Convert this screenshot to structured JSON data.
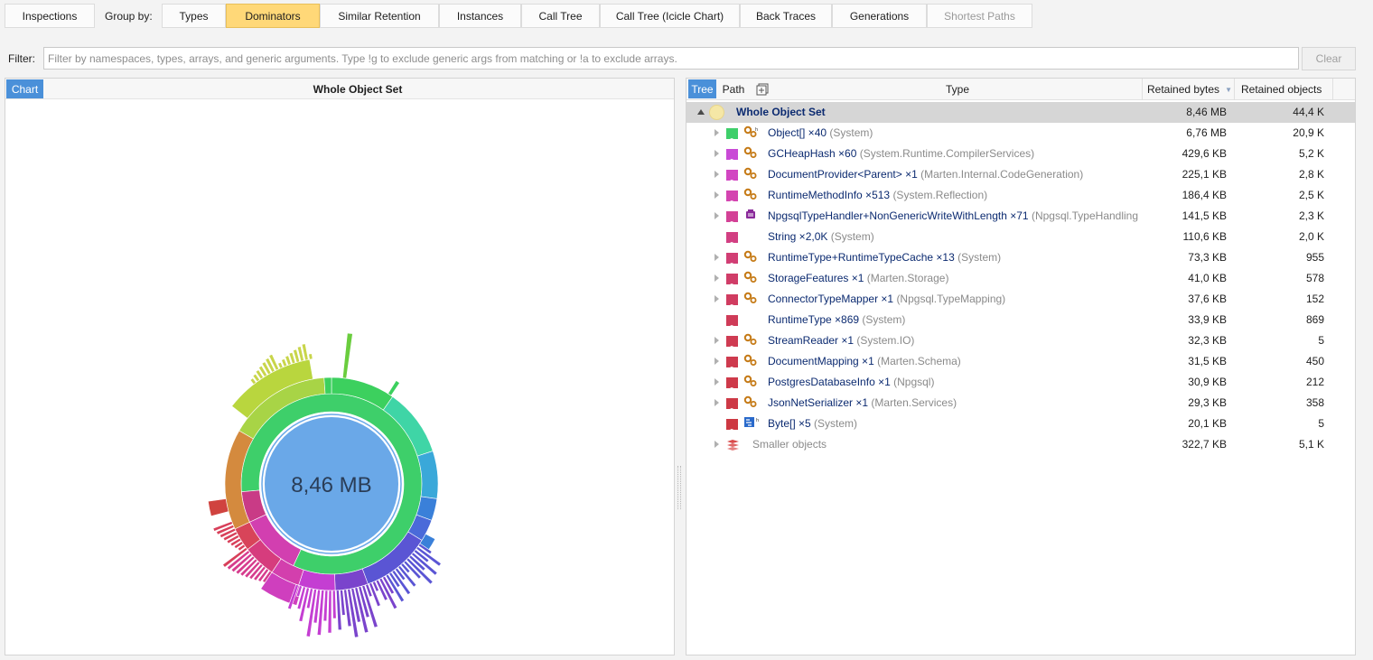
{
  "topbar": {
    "inspections": "Inspections",
    "group_by_label": "Group by:",
    "tabs": [
      "Types",
      "Dominators",
      "Similar Retention",
      "Instances",
      "Call Tree",
      "Call Tree (Icicle Chart)",
      "Back Traces",
      "Generations",
      "Shortest Paths"
    ],
    "active_tab": "Dominators",
    "disabled_tab": "Shortest Paths"
  },
  "filter": {
    "label": "Filter:",
    "placeholder": "Filter by namespaces, types, arrays, and generic arguments. Type !g to exclude generic args from matching or !a to exclude arrays.",
    "value": "",
    "clear_label": "Clear"
  },
  "left_pane": {
    "chart_tab": "Chart",
    "title": "Whole Object Set",
    "center_label": "8,46 MB"
  },
  "right_pane": {
    "tree_tab": "Tree",
    "path_tab": "Path",
    "columns": {
      "type": "Type",
      "retained_bytes": "Retained bytes",
      "retained_objects": "Retained objects"
    },
    "root": {
      "name": "Whole Object Set",
      "bytes": "8,46 MB",
      "objects": "44,4 K"
    },
    "rows": [
      {
        "name": "Object[] ×40",
        "ns": "(System)",
        "bytes": "6,76 MB",
        "objects": "20,9 K",
        "color": "#3ecf6a",
        "expandable": true,
        "icon": "array-gear-icon"
      },
      {
        "name": "GCHeapHash ×60",
        "ns": "(System.Runtime.CompilerServices)",
        "bytes": "429,6 KB",
        "objects": "5,2 K",
        "color": "#c94ad6",
        "expandable": true,
        "icon": "gear-icon"
      },
      {
        "name": "DocumentProvider<Parent> ×1",
        "ns": "(Marten.Internal.CodeGeneration)",
        "bytes": "225,1 KB",
        "objects": "2,8 K",
        "color": "#d246c2",
        "expandable": true,
        "icon": "gear-icon"
      },
      {
        "name": "RuntimeMethodInfo ×513",
        "ns": "(System.Reflection)",
        "bytes": "186,4 KB",
        "objects": "2,5 K",
        "color": "#d444b0",
        "expandable": true,
        "icon": "gear-icon"
      },
      {
        "name": "NpgsqlTypeHandler+NonGenericWriteWithLength ×71",
        "ns": "(Npgsql.TypeHandling",
        "bytes": "141,5 KB",
        "objects": "2,3 K",
        "color": "#d34196",
        "expandable": true,
        "icon": "delegate-icon"
      },
      {
        "name": "String ×2,0K",
        "ns": "(System)",
        "bytes": "110,6 KB",
        "objects": "2,0 K",
        "color": "#d23f82",
        "expandable": false,
        "icon": "none"
      },
      {
        "name": "RuntimeType+RuntimeTypeCache ×13",
        "ns": "(System)",
        "bytes": "73,3 KB",
        "objects": "955",
        "color": "#d13e74",
        "expandable": true,
        "icon": "gear-icon"
      },
      {
        "name": "StorageFeatures ×1",
        "ns": "(Marten.Storage)",
        "bytes": "41,0 KB",
        "objects": "578",
        "color": "#d03d68",
        "expandable": true,
        "icon": "gear-icon"
      },
      {
        "name": "ConnectorTypeMapper ×1",
        "ns": "(Npgsql.TypeMapping)",
        "bytes": "37,6 KB",
        "objects": "152",
        "color": "#d03c60",
        "expandable": true,
        "icon": "gear-icon"
      },
      {
        "name": "RuntimeType ×869",
        "ns": "(System)",
        "bytes": "33,9 KB",
        "objects": "869",
        "color": "#cf3b58",
        "expandable": false,
        "icon": "none"
      },
      {
        "name": "StreamReader ×1",
        "ns": "(System.IO)",
        "bytes": "32,3 KB",
        "objects": "5",
        "color": "#cf3b52",
        "expandable": true,
        "icon": "gear-icon"
      },
      {
        "name": "DocumentMapping ×1",
        "ns": "(Marten.Schema)",
        "bytes": "31,5 KB",
        "objects": "450",
        "color": "#ce3a4e",
        "expandable": true,
        "icon": "gear-icon"
      },
      {
        "name": "PostgresDatabaseInfo ×1",
        "ns": "(Npgsql)",
        "bytes": "30,9 KB",
        "objects": "212",
        "color": "#ce3a4a",
        "expandable": true,
        "icon": "gear-icon"
      },
      {
        "name": "JsonNetSerializer ×1",
        "ns": "(Marten.Services)",
        "bytes": "29,3 KB",
        "objects": "358",
        "color": "#cd3946",
        "expandable": true,
        "icon": "gear-icon"
      },
      {
        "name": "Byte[] ×5",
        "ns": "(System)",
        "bytes": "20,1 KB",
        "objects": "5",
        "color": "#cd3842",
        "expandable": false,
        "icon": "byte-array-icon"
      }
    ],
    "smaller": {
      "name": "Smaller objects",
      "bytes": "322,7 KB",
      "objects": "5,1 K"
    }
  }
}
